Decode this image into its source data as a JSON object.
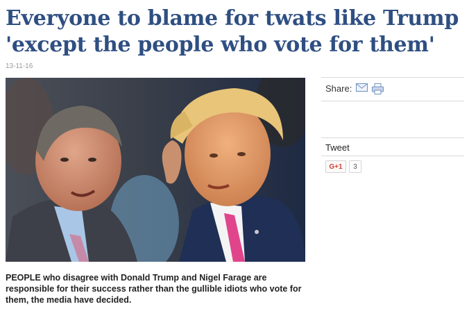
{
  "article": {
    "headline_line1": "Everyone to blame for twats like Trump",
    "headline_line2": "'except the people who vote for them'",
    "date": "13-11-16",
    "photo_alt": "",
    "caption": "PEOPLE who disagree with Donald Trump and Nigel Farage are responsible for their success rather than the gullible idiots who vote for them, the media have decided."
  },
  "sidebar": {
    "share_label": "Share:",
    "share_icons": [
      "email-icon",
      "print-icon"
    ],
    "tweet_label": "Tweet",
    "gplus_label": "G+1",
    "gplus_count": "3"
  },
  "colors": {
    "headline": "#2f4f82",
    "gplus": "#d23f31"
  }
}
